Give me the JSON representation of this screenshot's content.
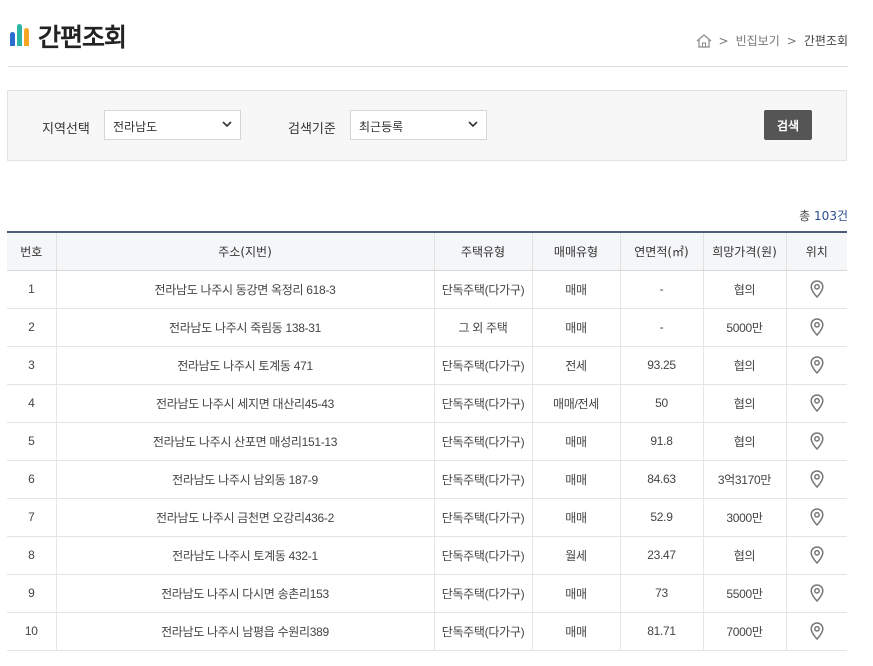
{
  "header": {
    "title": "간편조회"
  },
  "breadcrumb": {
    "items": [
      "빈집보기",
      "간편조회"
    ]
  },
  "search": {
    "region_label": "지역선택",
    "region_value": "전라남도",
    "criteria_label": "검색기준",
    "criteria_value": "최근등록",
    "button_label": "검색"
  },
  "summary": {
    "prefix": "총",
    "count": "103건"
  },
  "table": {
    "headers": [
      "번호",
      "주소(지번)",
      "주택유형",
      "매매유형",
      "연면적(㎡)",
      "희망가격(원)",
      "위치"
    ],
    "rows": [
      [
        "1",
        "전라남도 나주시 동강면 옥정리 618-3",
        "단독주택(다가구)",
        "매매",
        "-",
        "협의"
      ],
      [
        "2",
        "전라남도 나주시 죽림동 138-31",
        "그 외 주택",
        "매매",
        "-",
        "5000만"
      ],
      [
        "3",
        "전라남도 나주시 토계동 471",
        "단독주택(다가구)",
        "전세",
        "93.25",
        "협의"
      ],
      [
        "4",
        "전라남도 나주시 세지면 대산리45-43",
        "단독주택(다가구)",
        "매매/전세",
        "50",
        "협의"
      ],
      [
        "5",
        "전라남도 나주시 산포면 매성리151-13",
        "단독주택(다가구)",
        "매매",
        "91.8",
        "협의"
      ],
      [
        "6",
        "전라남도 나주시 남외동 187-9",
        "단독주택(다가구)",
        "매매",
        "84.63",
        "3억3170만"
      ],
      [
        "7",
        "전라남도 나주시 금천면 오강리436-2",
        "단독주택(다가구)",
        "매매",
        "52.9",
        "3000만"
      ],
      [
        "8",
        "전라남도 나주시 토계동 432-1",
        "단독주택(다가구)",
        "월세",
        "23.47",
        "협의"
      ],
      [
        "9",
        "전라남도 나주시 다시면 송촌리153",
        "단독주택(다가구)",
        "매매",
        "73",
        "5500만"
      ],
      [
        "10",
        "전라남도 나주시 남평읍 수원리389",
        "단독주택(다가구)",
        "매매",
        "81.71",
        "7000만"
      ]
    ]
  },
  "icons": {
    "location": "map-pin-icon",
    "home": "home-icon",
    "chevron": "chevron-down-icon"
  },
  "colors": {
    "header_border": "#4a5d7a",
    "button_bg": "#555555",
    "count": "#2a4d8f"
  }
}
